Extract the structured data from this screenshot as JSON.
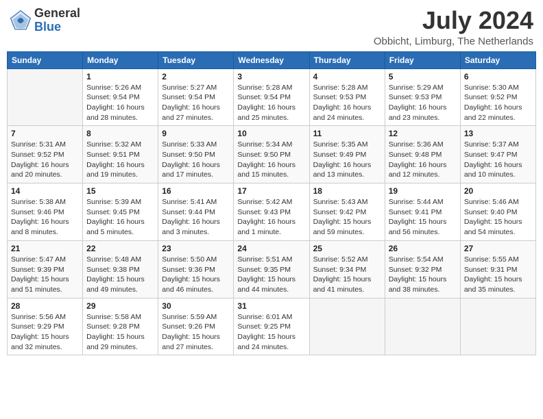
{
  "header": {
    "logo_general": "General",
    "logo_blue": "Blue",
    "month_title": "July 2024",
    "location": "Obbicht, Limburg, The Netherlands"
  },
  "days_of_week": [
    "Sunday",
    "Monday",
    "Tuesday",
    "Wednesday",
    "Thursday",
    "Friday",
    "Saturday"
  ],
  "weeks": [
    [
      {
        "day": "",
        "info": ""
      },
      {
        "day": "1",
        "info": "Sunrise: 5:26 AM\nSunset: 9:54 PM\nDaylight: 16 hours\nand 28 minutes."
      },
      {
        "day": "2",
        "info": "Sunrise: 5:27 AM\nSunset: 9:54 PM\nDaylight: 16 hours\nand 27 minutes."
      },
      {
        "day": "3",
        "info": "Sunrise: 5:28 AM\nSunset: 9:54 PM\nDaylight: 16 hours\nand 25 minutes."
      },
      {
        "day": "4",
        "info": "Sunrise: 5:28 AM\nSunset: 9:53 PM\nDaylight: 16 hours\nand 24 minutes."
      },
      {
        "day": "5",
        "info": "Sunrise: 5:29 AM\nSunset: 9:53 PM\nDaylight: 16 hours\nand 23 minutes."
      },
      {
        "day": "6",
        "info": "Sunrise: 5:30 AM\nSunset: 9:52 PM\nDaylight: 16 hours\nand 22 minutes."
      }
    ],
    [
      {
        "day": "7",
        "info": "Sunrise: 5:31 AM\nSunset: 9:52 PM\nDaylight: 16 hours\nand 20 minutes."
      },
      {
        "day": "8",
        "info": "Sunrise: 5:32 AM\nSunset: 9:51 PM\nDaylight: 16 hours\nand 19 minutes."
      },
      {
        "day": "9",
        "info": "Sunrise: 5:33 AM\nSunset: 9:50 PM\nDaylight: 16 hours\nand 17 minutes."
      },
      {
        "day": "10",
        "info": "Sunrise: 5:34 AM\nSunset: 9:50 PM\nDaylight: 16 hours\nand 15 minutes."
      },
      {
        "day": "11",
        "info": "Sunrise: 5:35 AM\nSunset: 9:49 PM\nDaylight: 16 hours\nand 13 minutes."
      },
      {
        "day": "12",
        "info": "Sunrise: 5:36 AM\nSunset: 9:48 PM\nDaylight: 16 hours\nand 12 minutes."
      },
      {
        "day": "13",
        "info": "Sunrise: 5:37 AM\nSunset: 9:47 PM\nDaylight: 16 hours\nand 10 minutes."
      }
    ],
    [
      {
        "day": "14",
        "info": "Sunrise: 5:38 AM\nSunset: 9:46 PM\nDaylight: 16 hours\nand 8 minutes."
      },
      {
        "day": "15",
        "info": "Sunrise: 5:39 AM\nSunset: 9:45 PM\nDaylight: 16 hours\nand 5 minutes."
      },
      {
        "day": "16",
        "info": "Sunrise: 5:41 AM\nSunset: 9:44 PM\nDaylight: 16 hours\nand 3 minutes."
      },
      {
        "day": "17",
        "info": "Sunrise: 5:42 AM\nSunset: 9:43 PM\nDaylight: 16 hours\nand 1 minute."
      },
      {
        "day": "18",
        "info": "Sunrise: 5:43 AM\nSunset: 9:42 PM\nDaylight: 15 hours\nand 59 minutes."
      },
      {
        "day": "19",
        "info": "Sunrise: 5:44 AM\nSunset: 9:41 PM\nDaylight: 15 hours\nand 56 minutes."
      },
      {
        "day": "20",
        "info": "Sunrise: 5:46 AM\nSunset: 9:40 PM\nDaylight: 15 hours\nand 54 minutes."
      }
    ],
    [
      {
        "day": "21",
        "info": "Sunrise: 5:47 AM\nSunset: 9:39 PM\nDaylight: 15 hours\nand 51 minutes."
      },
      {
        "day": "22",
        "info": "Sunrise: 5:48 AM\nSunset: 9:38 PM\nDaylight: 15 hours\nand 49 minutes."
      },
      {
        "day": "23",
        "info": "Sunrise: 5:50 AM\nSunset: 9:36 PM\nDaylight: 15 hours\nand 46 minutes."
      },
      {
        "day": "24",
        "info": "Sunrise: 5:51 AM\nSunset: 9:35 PM\nDaylight: 15 hours\nand 44 minutes."
      },
      {
        "day": "25",
        "info": "Sunrise: 5:52 AM\nSunset: 9:34 PM\nDaylight: 15 hours\nand 41 minutes."
      },
      {
        "day": "26",
        "info": "Sunrise: 5:54 AM\nSunset: 9:32 PM\nDaylight: 15 hours\nand 38 minutes."
      },
      {
        "day": "27",
        "info": "Sunrise: 5:55 AM\nSunset: 9:31 PM\nDaylight: 15 hours\nand 35 minutes."
      }
    ],
    [
      {
        "day": "28",
        "info": "Sunrise: 5:56 AM\nSunset: 9:29 PM\nDaylight: 15 hours\nand 32 minutes."
      },
      {
        "day": "29",
        "info": "Sunrise: 5:58 AM\nSunset: 9:28 PM\nDaylight: 15 hours\nand 29 minutes."
      },
      {
        "day": "30",
        "info": "Sunrise: 5:59 AM\nSunset: 9:26 PM\nDaylight: 15 hours\nand 27 minutes."
      },
      {
        "day": "31",
        "info": "Sunrise: 6:01 AM\nSunset: 9:25 PM\nDaylight: 15 hours\nand 24 minutes."
      },
      {
        "day": "",
        "info": ""
      },
      {
        "day": "",
        "info": ""
      },
      {
        "day": "",
        "info": ""
      }
    ]
  ]
}
